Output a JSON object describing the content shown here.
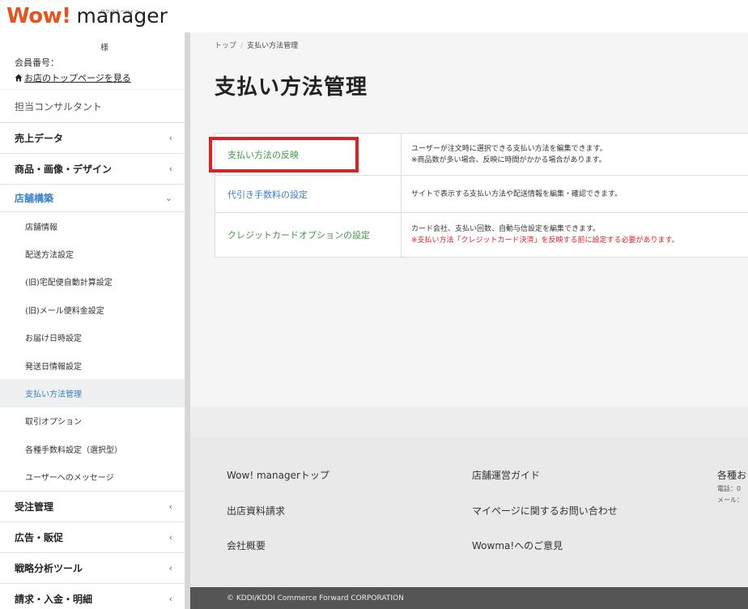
{
  "header": {
    "logo_wow": "Wow!",
    "logo_manager": "manager",
    "logo_ruby": "ワウマネージャー"
  },
  "sidebar": {
    "user_sama": "様",
    "member_no": "会員番号：",
    "shop_top_link": "お店のトップページを見る",
    "consultant": "担当コンサルタント",
    "menus": [
      {
        "label": "売上データ"
      },
      {
        "label": "商品・画像・デザイン"
      },
      {
        "label": "店舗構築"
      }
    ],
    "submenu": [
      "店舗情報",
      "配送方法設定",
      "(旧)宅配便自動計算設定",
      "(旧)メール便料金設定",
      "お届け日時設定",
      "発送日情報設定",
      "支払い方法管理",
      "取引オプション",
      "各種手数料設定（選択型）",
      "ユーザーへのメッセージ"
    ],
    "menus_bottom": [
      {
        "label": "受注管理"
      },
      {
        "label": "広告・販促"
      },
      {
        "label": "戦略分析ツール"
      },
      {
        "label": "請求・入金・明細"
      }
    ]
  },
  "main": {
    "breadcrumb": [
      "トップ",
      "支払い方法管理"
    ],
    "title": "支払い方法管理",
    "rows": [
      {
        "link": "支払い方法の反映",
        "desc": [
          "ユーザーが注文時に選択できる支払い方法を編集できます。",
          "※商品数が多い場合、反映に時間がかかる場合があります。"
        ]
      },
      {
        "link": "代引き手数料の設定",
        "desc": [
          "サイトで表示する支払い方法や配送情報を編集・確認できます。"
        ]
      },
      {
        "link": "クレジットカードオプションの設定",
        "desc": [
          "カード会社、支払い回数、自動与信設定を編集できます。"
        ],
        "note": "※支払い方法「クレジットカード決済」を反映する前に設定する必要があります。"
      }
    ]
  },
  "footer": {
    "col1": [
      "Wow! managerトップ",
      "出店資料請求",
      "会社概要"
    ],
    "col2": [
      "店舗運営ガイド",
      "マイページに関するお問い合わせ",
      "Wowma!へのご意見"
    ],
    "col3_title": "各種お",
    "col3_phone": "電話：0",
    "col3_mail": "メール：",
    "copyright": "© KDDI/KDDI Commerce Forward CORPORATION"
  },
  "colors": {
    "accent_blue": "#3a7fc9",
    "link_green": "#3d9a3d",
    "highlight_red": "#e02020",
    "logo_orange": "#e8531c"
  }
}
